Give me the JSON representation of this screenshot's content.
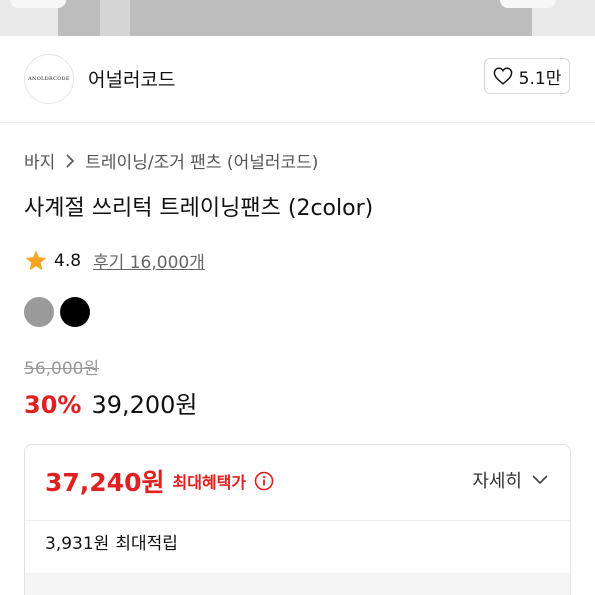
{
  "brand": {
    "logo_text": "ANOLDRCODE",
    "name": "어널러코드",
    "likes": "5.1만"
  },
  "breadcrumb": {
    "category": "바지",
    "subcategory": "트레이닝/조거 팬츠 (어널러코드)"
  },
  "product": {
    "title": "사계절 쓰리턱 트레이닝팬츠 (2color)",
    "rating": "4.8",
    "reviews": "후기 16,000개",
    "colors": [
      "#9a9a9a",
      "#000000"
    ]
  },
  "price": {
    "original": "56,000원",
    "discount_rate": "30%",
    "sale": "39,200원"
  },
  "benefit": {
    "max_price": "37,240원",
    "max_label": "최대혜택가",
    "detail_label": "자세히",
    "points_amount": "3,931원",
    "points_label": "최대적립"
  },
  "colors": {
    "accent_red": "#e02020",
    "star": "#f5a623"
  }
}
